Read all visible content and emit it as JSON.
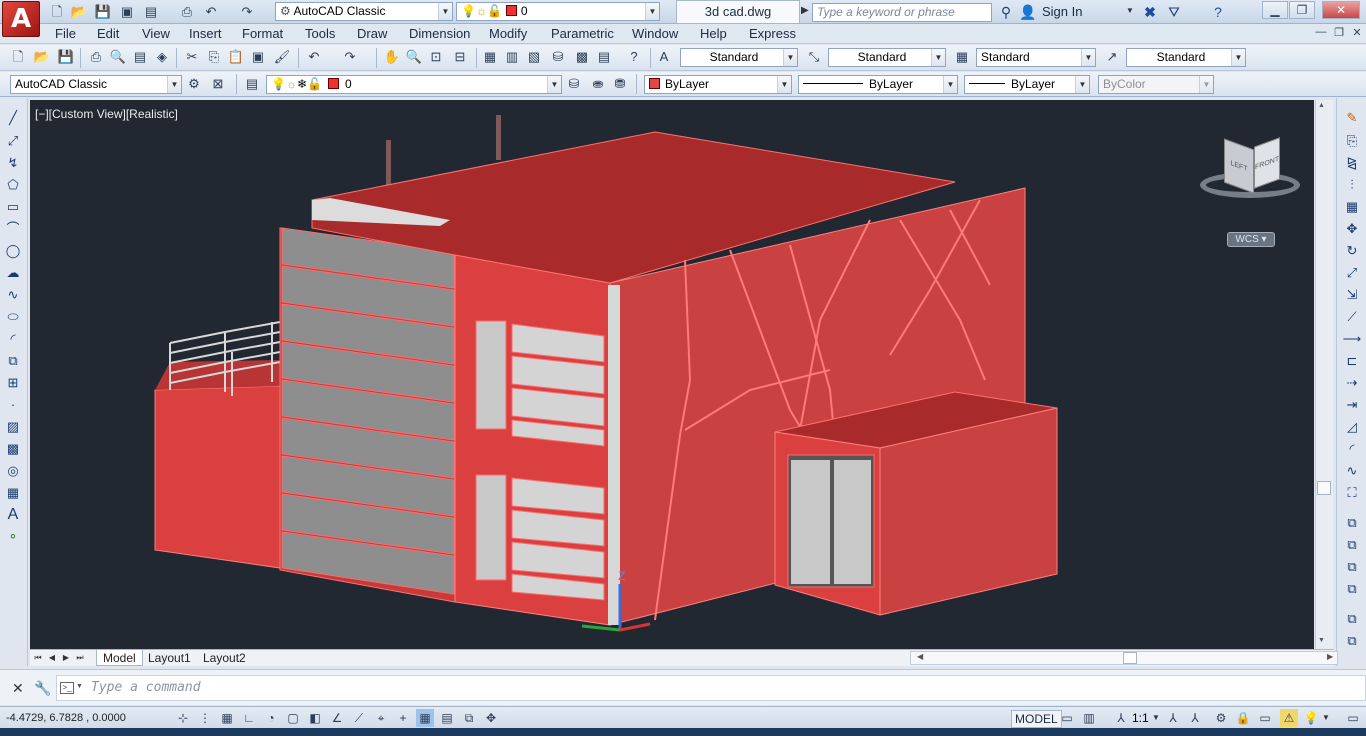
{
  "app": {
    "logo_glyph": "A",
    "document_title": "3d cad.dwg"
  },
  "quick_access": {
    "workspace_value": "AutoCAD Classic",
    "layer_value": "0",
    "search_placeholder": "Type a keyword or phrase",
    "signin_label": "Sign In",
    "icons": [
      "new-icon",
      "open-icon",
      "save-icon",
      "save-as-icon",
      "plot-preview-icon",
      "print-icon",
      "undo-icon",
      "redo-icon"
    ]
  },
  "menu": {
    "items": [
      "File",
      "Edit",
      "View",
      "Insert",
      "Format",
      "Tools",
      "Draw",
      "Dimension",
      "Modify",
      "Parametric",
      "Window",
      "Help",
      "Express"
    ]
  },
  "styles_toolbar": {
    "text_style": "Standard",
    "dim_style": "Standard",
    "table_style": "Standard",
    "mleader_style": "Standard"
  },
  "layers_toolbar": {
    "workspace_value": "AutoCAD Classic",
    "layer_value": "0",
    "color_value": "ByLayer",
    "linetype_value": "ByLayer",
    "lineweight_value": "ByLayer",
    "plotstyle_value": "ByColor"
  },
  "viewport": {
    "label": "[−][Custom View][Realistic]",
    "viewcube_left": "LEFT",
    "viewcube_front": "FRONT",
    "wcs_label": "WCS ▾",
    "ucs_z_label": "Z"
  },
  "layout_tabs": [
    "Model",
    "Layout1",
    "Layout2"
  ],
  "command_line": {
    "placeholder": "Type a command"
  },
  "status_bar": {
    "coordinates": "-4.4729, 6.7828 , 0.0000",
    "model_label": "MODEL",
    "annotation_scale": "1:1"
  },
  "colors": {
    "viewport_bg": "#222831",
    "building_red": "#d9403f",
    "roof_red": "#a82a2a",
    "panel_gray": "#8a8a8a",
    "accent_blue": "#1e5fb8"
  }
}
